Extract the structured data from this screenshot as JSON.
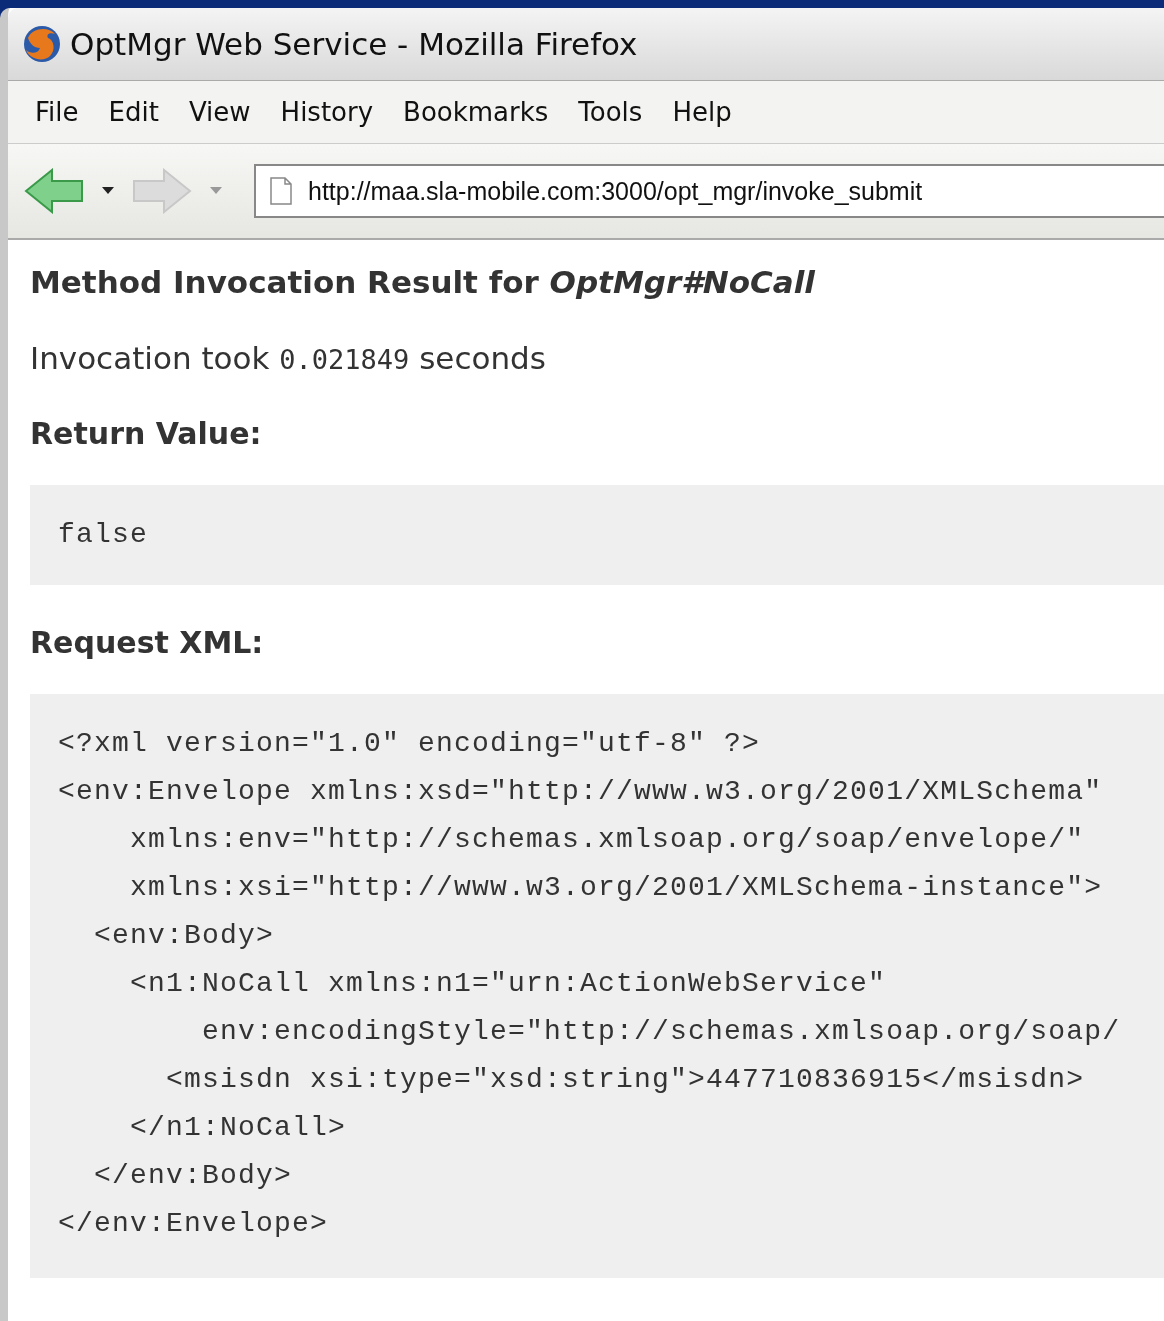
{
  "window": {
    "title": "OptMgr Web Service - Mozilla Firefox"
  },
  "menu": [
    {
      "label": "File"
    },
    {
      "label": "Edit"
    },
    {
      "label": "View"
    },
    {
      "label": "History"
    },
    {
      "label": "Bookmarks"
    },
    {
      "label": "Tools"
    },
    {
      "label": "Help"
    }
  ],
  "navigation": {
    "back_enabled": true,
    "forward_enabled": false,
    "url": "http://maa.sla-mobile.com:3000/opt_mgr/invoke_submit"
  },
  "page": {
    "heading": "Method Invocation Result for *OptMgr#NoCall*",
    "invocation": {
      "prefix": "Invocation took",
      "time": "0.021849",
      "suffix": "seconds"
    },
    "return_heading": "Return Value:",
    "return_value": "false",
    "request_heading": "Request XML:",
    "request_xml": [
      "<?xml version=\"1.0\" encoding=\"utf-8\" ?>",
      "<env:Envelope xmlns:xsd=\"http://www.w3.org/2001/XMLSchema\"",
      "    xmlns:env=\"http://schemas.xmlsoap.org/soap/envelope/\"",
      "    xmlns:xsi=\"http://www.w3.org/2001/XMLSchema-instance\">",
      "  <env:Body>",
      "    <n1:NoCall xmlns:n1=\"urn:ActionWebService\"",
      "        env:encodingStyle=\"http://schemas.xmlsoap.org/soap/",
      "      <msisdn xsi:type=\"xsd:string\">447710836915</msisdn>",
      "    </n1:NoCall>",
      "  </env:Body>",
      "</env:Envelope>"
    ]
  }
}
